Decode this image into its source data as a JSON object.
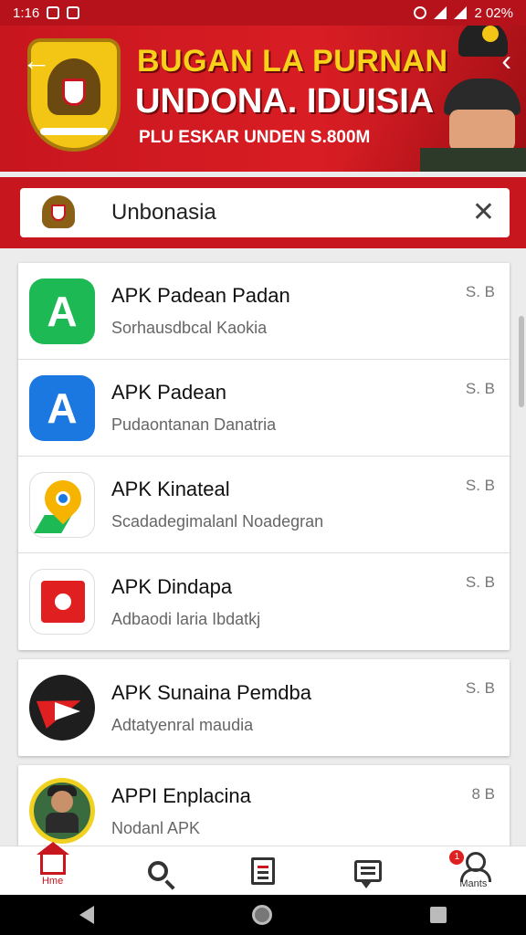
{
  "status_bar": {
    "time": "1:16",
    "battery": "2 02%"
  },
  "banner": {
    "title_line1": "BUGAN LA PURNAN",
    "title_line2": "UNDONA. IDUISIA",
    "subtitle": "PLU ESKAR UNDEN S.800M"
  },
  "search": {
    "value": "Unbonasia"
  },
  "results": [
    {
      "title": "APK Padean Padan",
      "subtitle": "Sorhausdbcal Kaokia",
      "meta": "S. B",
      "icon": "green-a-icon"
    },
    {
      "title": "APK Padean",
      "subtitle": "Pudaontanan Danatria",
      "meta": "S. B",
      "icon": "blue-a-icon"
    },
    {
      "title": "APK Kinateal",
      "subtitle": "Scadadegimalanl Noadegran",
      "meta": "S. B",
      "icon": "map-pin-icon"
    },
    {
      "title": "APK Dindapa",
      "subtitle": "Adbaodi laria Ibdatkj",
      "meta": "S. B",
      "icon": "red-doc-icon"
    },
    {
      "title": "APK Sunaina Pemdba",
      "subtitle": "Adtatyenral maudia",
      "meta": "S. B",
      "icon": "red-arrow-icon"
    },
    {
      "title": "APPI Enplacina",
      "subtitle": "Nodanl APK",
      "meta": "8 B",
      "icon": "avatar-icon"
    }
  ],
  "bottom_nav": {
    "home_label": "Hme",
    "profile_label": "Mants",
    "badge": "1"
  },
  "colors": {
    "accent": "#c8161e",
    "banner_title": "#f8d21a"
  }
}
